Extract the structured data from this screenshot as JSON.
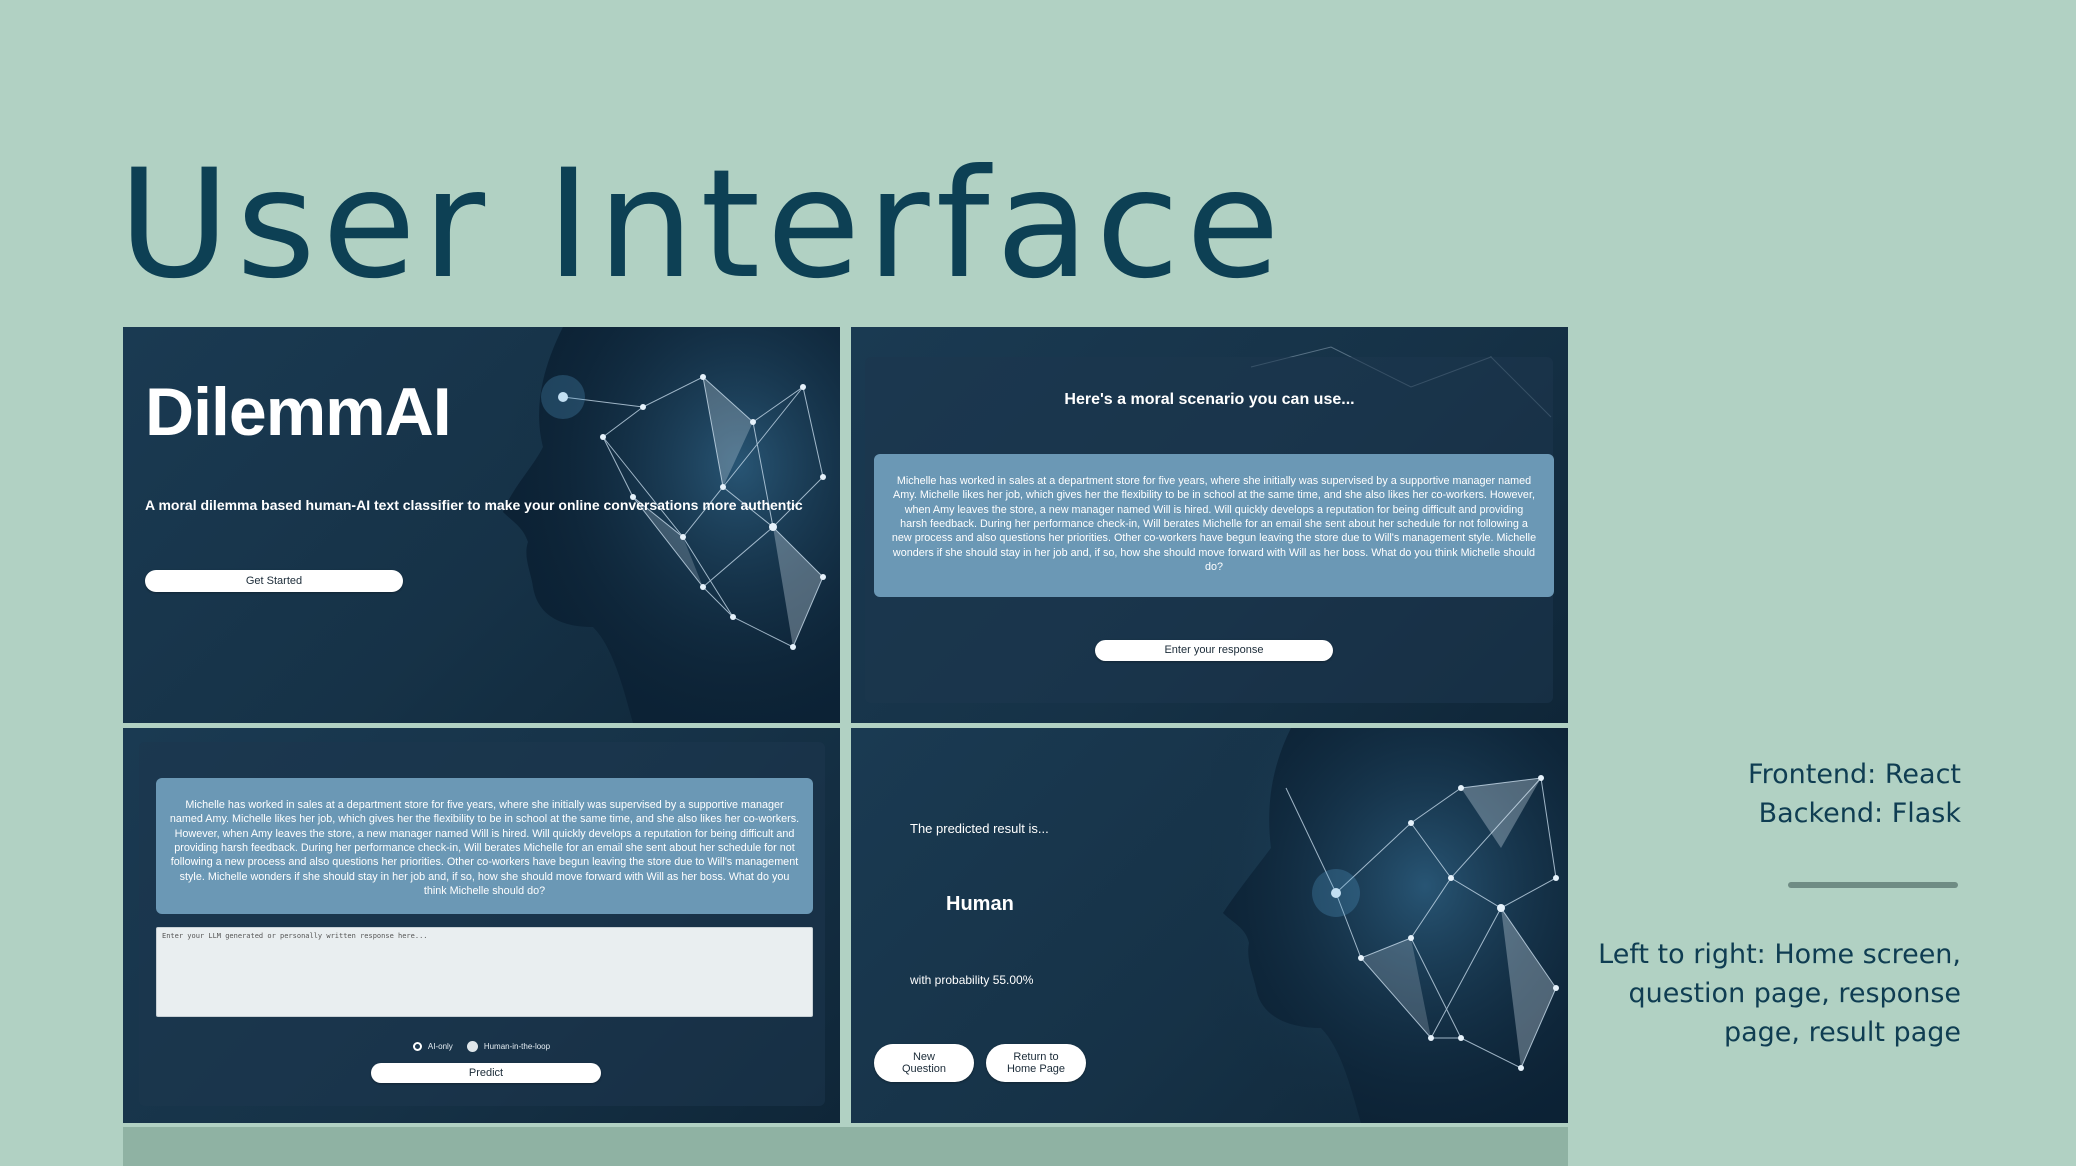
{
  "slide": {
    "title": "User Interface",
    "frontend": "Frontend: React",
    "backend": "Backend: Flask",
    "caption": [
      "Left to right: Home screen,",
      "question page, response",
      "page, result page"
    ]
  },
  "home": {
    "brand": "DilemmAI",
    "tagline": "A moral dilemma based human-AI text classifier to make your online conversations more authentic",
    "get_started": "Get Started"
  },
  "question": {
    "heading": "Here's a moral scenario you can use...",
    "scenario": "Michelle has worked in sales at a department store for five years, where she initially was supervised by a supportive manager named Amy. Michelle likes her job, which gives her the flexibility to be in school at the same time, and she also likes her co-workers. However, when Amy leaves the store, a new manager named Will is hired. Will quickly develops a reputation for being difficult and providing harsh feedback. During her performance check-in, Will berates Michelle for an email she sent about her schedule for not following a new process and also questions her priorities. Other co-workers have begun leaving the store due to Will's management style. Michelle wonders if she should stay in her job and, if so, how she should move forward with Will as her boss. What do you think Michelle should do?",
    "enter_response": "Enter your response"
  },
  "response": {
    "scenario": "Michelle has worked in sales at a department store for five years, where she initially was supervised by a supportive manager named Amy. Michelle likes her job, which gives her the flexibility to be in school at the same time, and she also likes her co-workers. However, when Amy leaves the store, a new manager named Will is hired. Will quickly develops a reputation for being difficult and providing harsh feedback. During her performance check-in, Will berates Michelle for an email she sent about her schedule for not following a new process and also questions her priorities. Other co-workers have begun leaving the store due to Will's management style. Michelle wonders if she should stay in her job and, if so, how she should move forward with Will as her boss. What do you think Michelle should do?",
    "placeholder": "Enter your LLM generated or personally written response here...",
    "option_ai": "AI-only",
    "option_human": "Human-in-the-loop",
    "selected_option": "AI-only",
    "predict": "Predict"
  },
  "result": {
    "intro": "The predicted result is...",
    "label": "Human",
    "probability": "with probability 55.00%",
    "new_question": [
      "New",
      "Question"
    ],
    "return_home": [
      "Return to",
      "Home Page"
    ]
  },
  "colors": {
    "background": "#b1d1c3",
    "title": "#0d4054",
    "panel": "#1a3a52",
    "scenario_box": "#6b98b5"
  }
}
